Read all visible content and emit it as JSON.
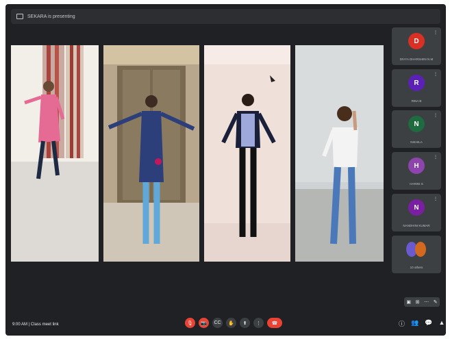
{
  "banner": {
    "text": "SEKARA is presenting",
    "icon": "present-screen-icon"
  },
  "tiles": [
    {
      "id": "dancer-1",
      "description_icon": "video-feed"
    },
    {
      "id": "dancer-2",
      "description_icon": "video-feed"
    },
    {
      "id": "dancer-3",
      "description_icon": "video-feed"
    },
    {
      "id": "dancer-4",
      "description_icon": "video-feed"
    }
  ],
  "participants": [
    {
      "initial": "D",
      "name": "DIVYA DHARSHINI N M",
      "color": "#d93025",
      "muted": true
    },
    {
      "initial": "R",
      "name": "RINA B",
      "color": "#5b21b6",
      "muted": true
    },
    {
      "initial": "N",
      "name": "NIKHILA",
      "color": "#1e6b40",
      "muted": true
    },
    {
      "initial": "H",
      "name": "HARINI S",
      "color": "#8e44ad",
      "muted": true
    },
    {
      "initial": "N",
      "name": "NANDHINI KUMAR",
      "color": "#7b1fa2",
      "muted": true
    }
  ],
  "others_tile": {
    "label": "10 others",
    "colors": [
      "#6a5acd",
      "#d2691e"
    ]
  },
  "mini_controls": [
    "pin-icon",
    "grid-icon",
    "more-icon",
    "edit-icon"
  ],
  "bottom_bar": {
    "time_info": "9:00 AM  |  Class meet link",
    "controls": [
      {
        "name": "mic-off-button",
        "glyph": "🎙",
        "red": true
      },
      {
        "name": "camera-off-button",
        "glyph": "📷",
        "red": true
      },
      {
        "name": "captions-button",
        "glyph": "CC",
        "red": false
      },
      {
        "name": "raise-hand-button",
        "glyph": "✋",
        "red": false
      },
      {
        "name": "present-button",
        "glyph": "⬆",
        "red": false
      },
      {
        "name": "more-options-button",
        "glyph": "⋮",
        "red": false
      }
    ],
    "end_call_glyph": "☎",
    "right_icons": [
      {
        "name": "info-icon",
        "glyph": "ⓘ"
      },
      {
        "name": "people-icon",
        "glyph": "👥"
      },
      {
        "name": "chat-icon",
        "glyph": "💬"
      },
      {
        "name": "activities-icon",
        "glyph": "▲"
      }
    ]
  }
}
